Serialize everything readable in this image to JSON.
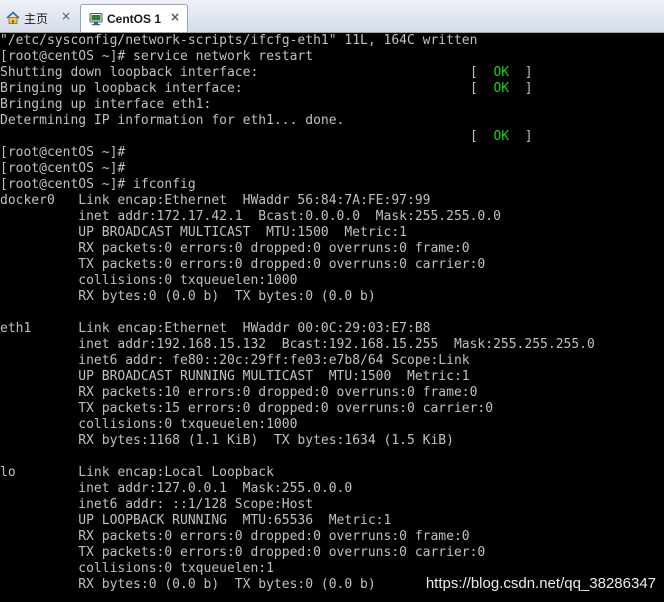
{
  "tabs": [
    {
      "label": "主页",
      "icon": "home-icon"
    },
    {
      "label": "CentOS 1",
      "icon": "vm-icon"
    }
  ],
  "tab_close_glyph": "×",
  "terminal": {
    "lines": [
      "\"/etc/sysconfig/network-scripts/ifcfg-eth1\" 11L, 164C written",
      "[root@centOS ~]# service network restart",
      "Shutting down loopback interface:",
      "Bringing up loopback interface:",
      "Bringing up interface eth1:",
      "Determining IP information for eth1... done.",
      "",
      "[root@centOS ~]#",
      "[root@centOS ~]#",
      "[root@centOS ~]# ifconfig",
      "docker0   Link encap:Ethernet  HWaddr 56:84:7A:FE:97:99",
      "          inet addr:172.17.42.1  Bcast:0.0.0.0  Mask:255.255.0.0",
      "          UP BROADCAST MULTICAST  MTU:1500  Metric:1",
      "          RX packets:0 errors:0 dropped:0 overruns:0 frame:0",
      "          TX packets:0 errors:0 dropped:0 overruns:0 carrier:0",
      "          collisions:0 txqueuelen:1000",
      "          RX bytes:0 (0.0 b)  TX bytes:0 (0.0 b)",
      "",
      "eth1      Link encap:Ethernet  HWaddr 00:0C:29:03:E7:B8",
      "          inet addr:192.168.15.132  Bcast:192.168.15.255  Mask:255.255.255.0",
      "          inet6 addr: fe80::20c:29ff:fe03:e7b8/64 Scope:Link",
      "          UP BROADCAST RUNNING MULTICAST  MTU:1500  Metric:1",
      "          RX packets:10 errors:0 dropped:0 overruns:0 frame:0",
      "          TX packets:15 errors:0 dropped:0 overruns:0 carrier:0",
      "          collisions:0 txqueuelen:1000",
      "          RX bytes:1168 (1.1 KiB)  TX bytes:1634 (1.5 KiB)",
      "",
      "lo        Link encap:Local Loopback",
      "          inet addr:127.0.0.1  Mask:255.0.0.0",
      "          inet6 addr: ::1/128 Scope:Host",
      "          UP LOOPBACK RUNNING  MTU:65536  Metric:1",
      "          RX packets:0 errors:0 dropped:0 overruns:0 frame:0",
      "          TX packets:0 errors:0 dropped:0 overruns:0 carrier:0",
      "          collisions:0 txqueuelen:1",
      "          RX bytes:0 (0.0 b)  TX bytes:0 (0.0 b)"
    ],
    "status_ok": {
      "open": "[  ",
      "text": "OK",
      "close": "  ]",
      "lines": [
        2,
        3,
        6
      ]
    },
    "colors": {
      "background": "#000000",
      "text": "#c0c0c0",
      "ok": "#19d319"
    }
  },
  "watermark": "https://blog.csdn.net/qq_38286347"
}
